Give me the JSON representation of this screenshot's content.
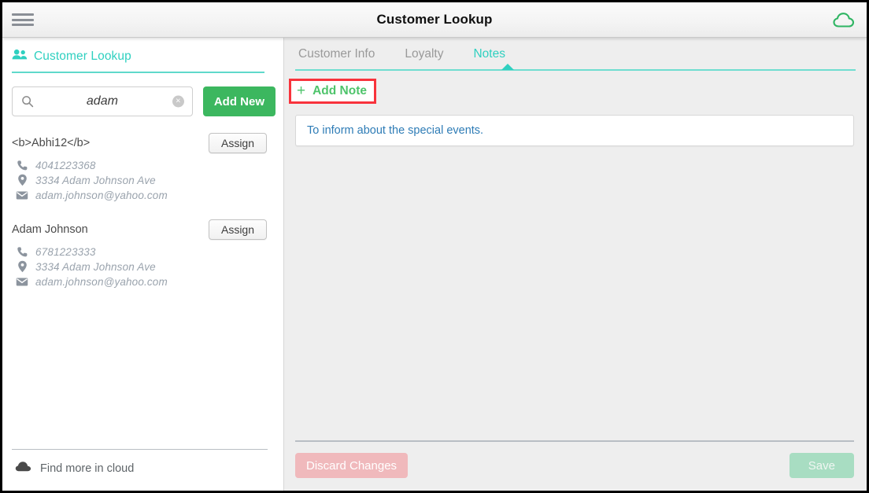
{
  "header": {
    "title": "Customer Lookup",
    "menu_icon": "hamburger-menu-icon",
    "cloud_icon": "cloud-outline-icon"
  },
  "sidebar": {
    "title": "Customer Lookup",
    "title_icon": "people-group-icon",
    "search": {
      "value": "adam",
      "placeholder": "",
      "search_icon": "search-icon",
      "clear_icon": "clear-circle-icon",
      "clear_glyph": "×"
    },
    "add_new_label": "Add New",
    "customers": [
      {
        "name": "<b>Abhi12</b>",
        "assign_label": "Assign",
        "phone": "4041223368",
        "address": "3334 Adam Johnson Ave",
        "email": "adam.johnson@yahoo.com"
      },
      {
        "name": "Adam Johnson",
        "assign_label": "Assign",
        "phone": "6781223333",
        "address": "3334 Adam Johnson Ave",
        "email": "adam.johnson@yahoo.com"
      }
    ],
    "footer": {
      "label": "Find more in cloud",
      "icon": "cloud-solid-icon"
    }
  },
  "main": {
    "tabs": [
      {
        "label": "Customer Info",
        "active": false
      },
      {
        "label": "Loyalty",
        "active": false
      },
      {
        "label": "Notes",
        "active": true
      }
    ],
    "add_note": {
      "plus": "+",
      "label": "Add Note",
      "highlight_color": "#f8333c"
    },
    "notes": [
      {
        "text": "To inform about the special events."
      }
    ],
    "footer": {
      "discard_label": "Discard Changes",
      "save_label": "Save"
    }
  },
  "colors": {
    "teal": "#2fd0c0",
    "green": "#3cb75f",
    "note_blue": "#2e7cb6",
    "discard_pink": "#f0b9bc",
    "save_mint": "#a8ddc2"
  }
}
